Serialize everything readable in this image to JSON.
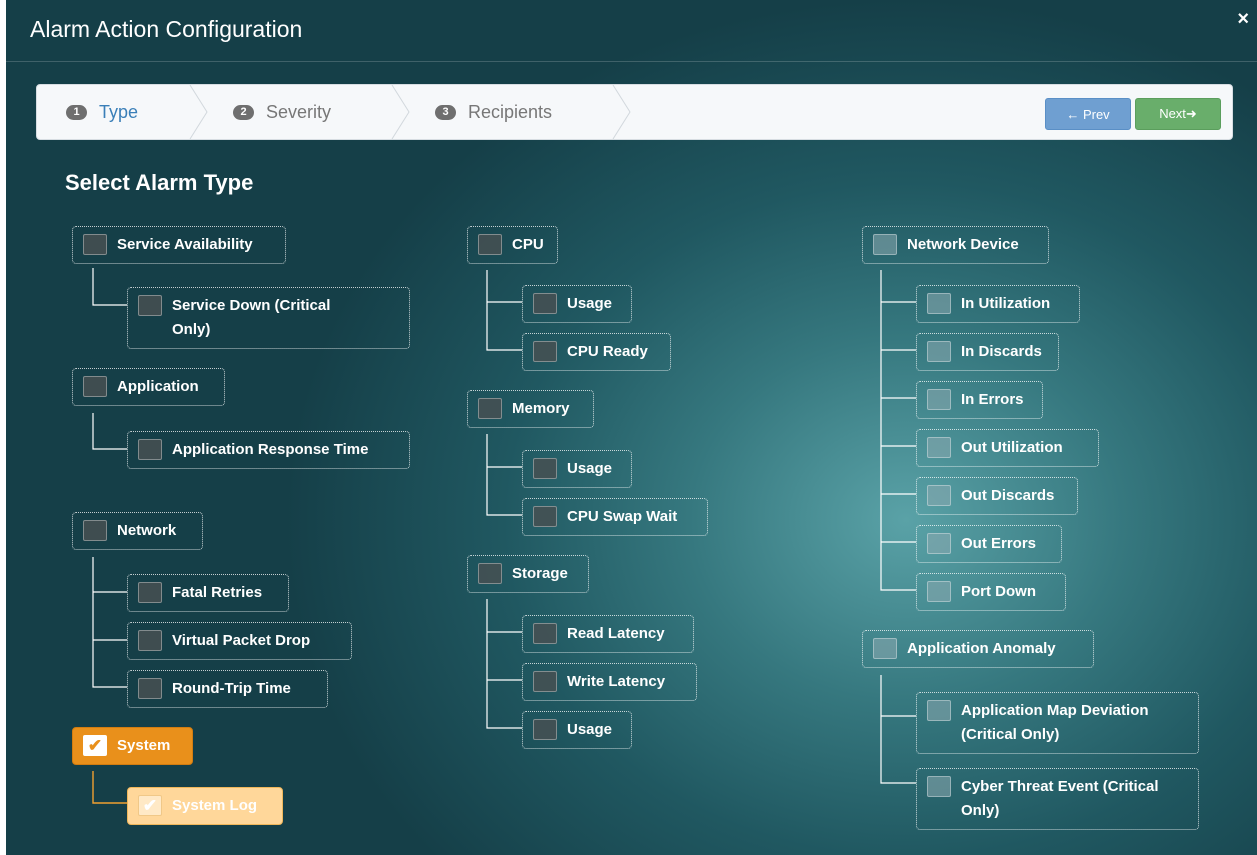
{
  "dialog": {
    "title": "Alarm Action Configuration",
    "close_icon": "×"
  },
  "wizard": {
    "steps": [
      {
        "number": "1",
        "label": "Type",
        "active": true
      },
      {
        "number": "2",
        "label": "Severity",
        "active": false
      },
      {
        "number": "3",
        "label": "Recipients",
        "active": false
      }
    ],
    "prev_label": "← Prev",
    "next_label": "Next➜"
  },
  "section_title": "Select Alarm Type",
  "tree": {
    "service_availability": {
      "label": "Service Availability",
      "checked": false
    },
    "service_down": {
      "label": "Service Down (Critical Only)",
      "checked": false
    },
    "application": {
      "label": "Application",
      "checked": false
    },
    "application_response_time": {
      "label": "Application Response Time",
      "checked": false
    },
    "network": {
      "label": "Network",
      "checked": false
    },
    "fatal_retries": {
      "label": "Fatal Retries",
      "checked": false
    },
    "virtual_packet_drop": {
      "label": "Virtual Packet Drop",
      "checked": false
    },
    "round_trip_time": {
      "label": "Round-Trip Time",
      "checked": false
    },
    "system": {
      "label": "System",
      "checked": true
    },
    "system_log": {
      "label": "System Log",
      "checked": true
    },
    "cpu": {
      "label": "CPU",
      "checked": false
    },
    "cpu_usage": {
      "label": "Usage",
      "checked": false
    },
    "cpu_ready": {
      "label": "CPU Ready",
      "checked": false
    },
    "memory": {
      "label": "Memory",
      "checked": false
    },
    "memory_usage": {
      "label": "Usage",
      "checked": false
    },
    "cpu_swap_wait": {
      "label": "CPU Swap Wait",
      "checked": false
    },
    "storage": {
      "label": "Storage",
      "checked": false
    },
    "read_latency": {
      "label": "Read Latency",
      "checked": false
    },
    "write_latency": {
      "label": "Write Latency",
      "checked": false
    },
    "storage_usage": {
      "label": "Usage",
      "checked": false
    },
    "network_device": {
      "label": "Network Device",
      "checked": false
    },
    "in_utilization": {
      "label": "In Utilization",
      "checked": false
    },
    "in_discards": {
      "label": "In Discards",
      "checked": false
    },
    "in_errors": {
      "label": "In Errors",
      "checked": false
    },
    "out_utilization": {
      "label": "Out Utilization",
      "checked": false
    },
    "out_discards": {
      "label": "Out Discards",
      "checked": false
    },
    "out_errors": {
      "label": "Out Errors",
      "checked": false
    },
    "port_down": {
      "label": "Port Down",
      "checked": false
    },
    "application_anomaly": {
      "label": "Application Anomaly",
      "checked": false
    },
    "application_map_deviation": {
      "label": "Application Map Deviation (Critical Only)",
      "checked": false
    },
    "cyber_threat_event": {
      "label": "Cyber Threat Event (Critical Only)",
      "checked": false
    }
  },
  "colors": {
    "selected_parent": "#e9901b",
    "selected_child": "#ffd79a",
    "active_step": "#3a7fb8",
    "prev_button": "#6f9fd1",
    "next_button": "#69ae6b"
  }
}
